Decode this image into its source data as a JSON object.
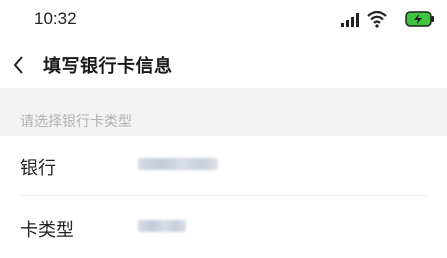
{
  "status_bar": {
    "time": "10:32",
    "icons": [
      "signal-icon",
      "wifi-icon",
      "battery-charging-icon"
    ],
    "battery_color": "#3ec43e"
  },
  "nav": {
    "title": "填写银行卡信息",
    "back_icon": "chevron-left-icon"
  },
  "section": {
    "header": "请选择银行卡类型"
  },
  "form": {
    "rows": [
      {
        "label": "银行",
        "value": ""
      },
      {
        "label": "卡类型",
        "value": ""
      }
    ]
  },
  "colors": {
    "background": "#f2f2f2",
    "card": "#ffffff",
    "muted_text": "#b2b2b2"
  }
}
